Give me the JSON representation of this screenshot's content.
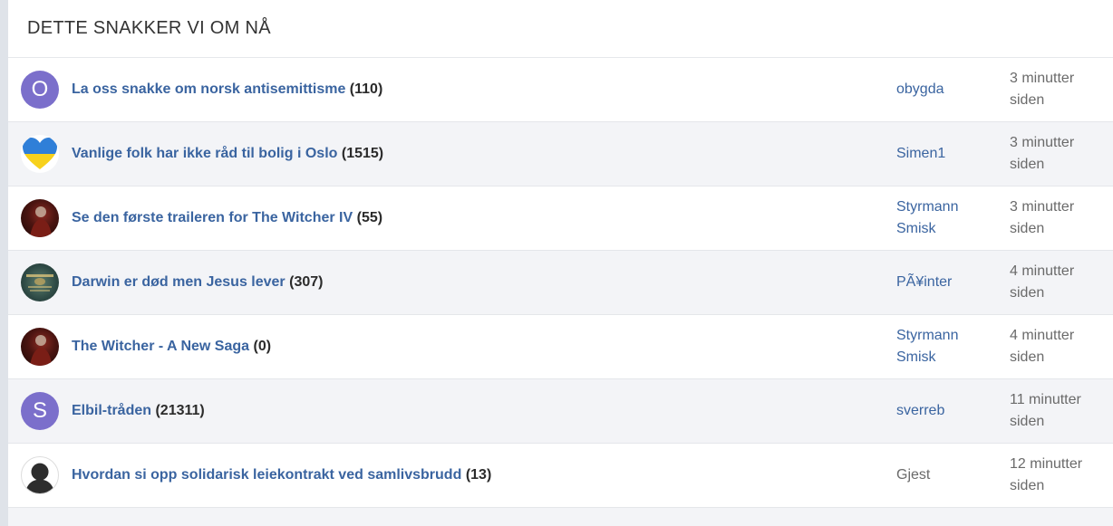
{
  "header": {
    "title": "DETTE SNAKKER VI OM NÅ"
  },
  "colors": {
    "link": "#3a64a0",
    "avatar_purple": "#7b6fcb",
    "alt_row": "#f3f4f7"
  },
  "topics": [
    {
      "avatar_type": "letter",
      "avatar_letter": "O",
      "title": "La oss snakke om norsk antisemittisme",
      "count": "(110)",
      "user": "obygda",
      "time": "3 minutter siden"
    },
    {
      "avatar_type": "heart",
      "avatar_icon": "ukraine-heart-icon",
      "title": "Vanlige folk har ikke råd til bolig i Oslo",
      "count": "(1515)",
      "user": "Simen1",
      "time": "3 minutter siden"
    },
    {
      "avatar_type": "image",
      "avatar_icon": "witcher-avatar",
      "title": "Se den første traileren for The Witcher IV",
      "count": "(55)",
      "user": "Styrmann Smisk",
      "time": "3 minutter siden"
    },
    {
      "avatar_type": "image",
      "avatar_icon": "darwin-avatar",
      "title": "Darwin er død men Jesus lever",
      "count": "(307)",
      "user": "PÃ¥inter",
      "time": "4 minutter siden"
    },
    {
      "avatar_type": "image",
      "avatar_icon": "witcher-avatar",
      "title": "The Witcher - A New Saga",
      "count": "(0)",
      "user": "Styrmann Smisk",
      "time": "4 minutter siden"
    },
    {
      "avatar_type": "letter",
      "avatar_letter": "S",
      "title": "Elbil-tråden",
      "count": "(21311)",
      "user": "sverreb",
      "time": "11 minutter siden"
    },
    {
      "avatar_type": "guest",
      "avatar_icon": "guest-avatar-icon",
      "title": "Hvordan si opp solidarisk leiekontrakt ved samlivsbrudd",
      "count": "(13)",
      "user": "Gjest",
      "time": "12 minutter siden"
    }
  ]
}
